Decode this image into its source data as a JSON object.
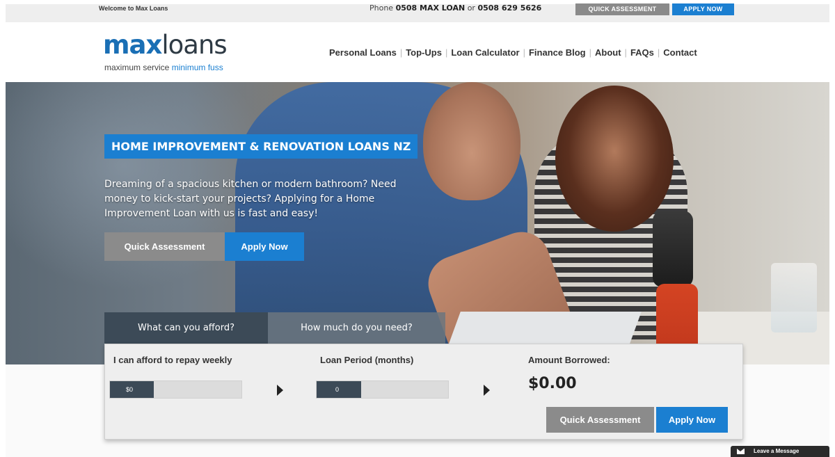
{
  "topbar": {
    "welcome": "Welcome to Max Loans",
    "phone_prefix": "Phone",
    "phone_1": "0508 MAX LOAN",
    "phone_or": "or",
    "phone_2": "0508 629 5626",
    "quick_assessment": "QUICK ASSESSMENT",
    "apply_now": "APPLY NOW"
  },
  "header": {
    "logo_max": "max",
    "logo_loans": "loans",
    "tagline_1": "maximum service",
    "tagline_2": "minimum fuss"
  },
  "nav": {
    "items": [
      {
        "label": "Personal Loans"
      },
      {
        "label": "Top-Ups"
      },
      {
        "label": "Loan Calculator"
      },
      {
        "label": "Finance Blog"
      },
      {
        "label": "About"
      },
      {
        "label": "FAQs"
      },
      {
        "label": "Contact"
      }
    ],
    "separator": "|"
  },
  "hero": {
    "title": "HOME IMPROVEMENT & RENOVATION LOANS NZ",
    "text": "Dreaming of a spacious kitchen or modern bathroom? Need money to kick-start your projects? Applying for a Home Improvement Loan with us is fast and easy!",
    "quick_assessment": "Quick Assessment",
    "apply_now": "Apply Now"
  },
  "calculator": {
    "tabs": [
      {
        "label": "What can you afford?",
        "active": true
      },
      {
        "label": "How much do you need?",
        "active": false
      }
    ],
    "repay_label": "I can afford to repay weekly",
    "repay_value": "$0",
    "period_label": "Loan Period (months)",
    "period_value": "0",
    "amount_label": "Amount Borrowed:",
    "amount_value": "$0.00",
    "quick_assessment": "Quick Assessment",
    "apply_now": "Apply Now"
  },
  "chat": {
    "label": "Leave a Message",
    "icon": "envelope-icon"
  },
  "colors": {
    "brand_blue": "#1b7fd1",
    "dark_slate": "#3c4a57",
    "grey_button": "#8b8b8b"
  }
}
